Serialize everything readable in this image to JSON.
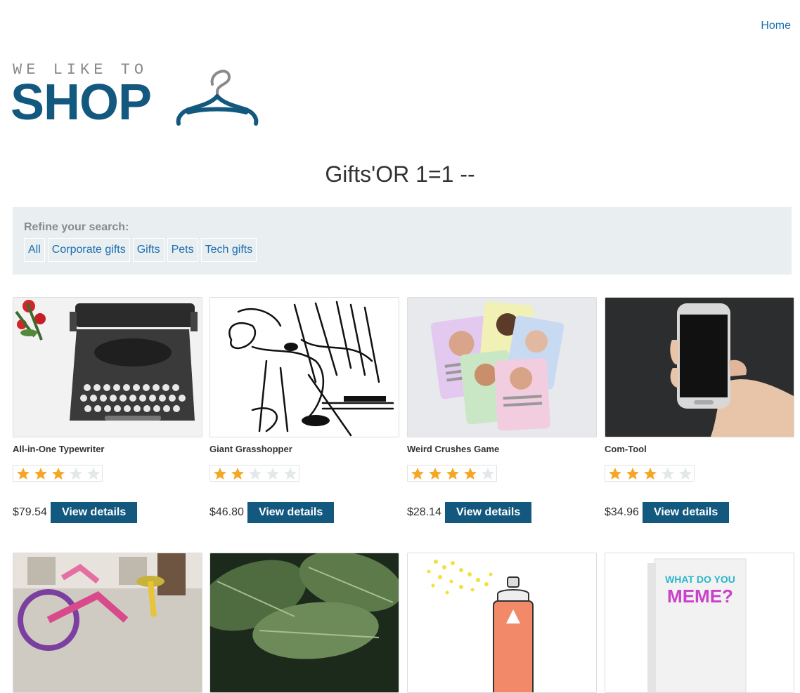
{
  "nav": {
    "home_label": "Home"
  },
  "logo": {
    "small_text": "WE LIKE TO",
    "big_text": "SHOP"
  },
  "search": {
    "title": "Gifts'OR 1=1 --"
  },
  "refine": {
    "label": "Refine your search:",
    "filters": [
      "All",
      "Corporate gifts",
      "Gifts",
      "Pets",
      "Tech gifts"
    ]
  },
  "products": [
    {
      "name": "All-in-One Typewriter",
      "rating": 3,
      "price": "$79.54",
      "button": "View details",
      "image": "typewriter-image"
    },
    {
      "name": "Giant Grasshopper",
      "rating": 2,
      "price": "$46.80",
      "button": "View details",
      "image": "grasshopper-sketch-image"
    },
    {
      "name": "Weird Crushes Game",
      "rating": 4,
      "price": "$28.14",
      "button": "View details",
      "image": "crush-cards-image"
    },
    {
      "name": "Com-Tool",
      "rating": 3,
      "price": "$34.96",
      "button": "View details",
      "image": "smartphone-hand-image"
    },
    {
      "image": "knitted-bicycle-image"
    },
    {
      "image": "leaves-image"
    },
    {
      "image": "spray-can-image"
    },
    {
      "image": "what-do-you-meme-box-image",
      "box_text_1": "WHAT DO YOU",
      "box_text_2": "MEME?"
    }
  ],
  "colors": {
    "brand": "#13587f",
    "link": "#1a6fb0",
    "star": "#f5a623",
    "star_empty": "#e3e8ea",
    "refine_bg": "#e9eef1"
  }
}
